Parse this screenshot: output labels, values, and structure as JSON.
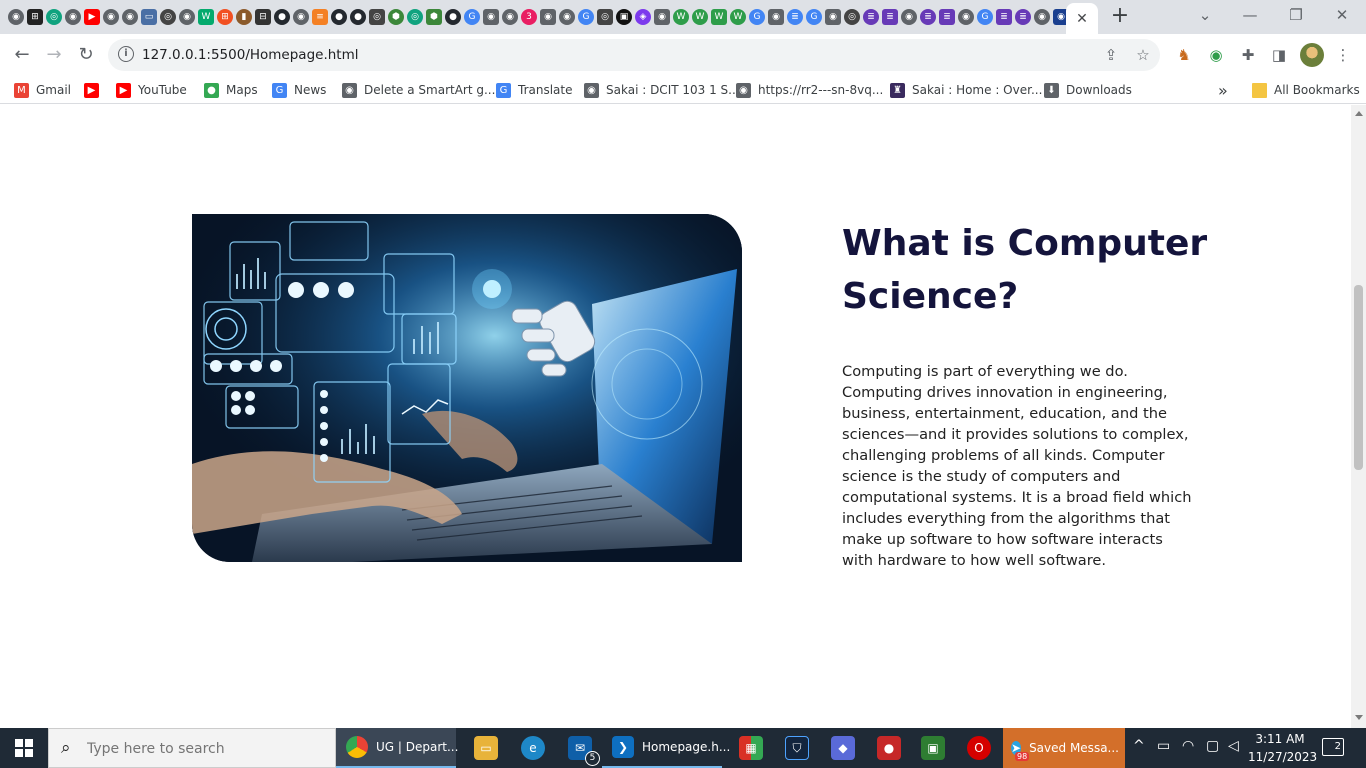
{
  "browser": {
    "address": "127.0.0.1:5500/Homepage.html",
    "close_tab": "✕",
    "new_tab": "+",
    "tab_favicons": [
      {
        "icon": "chrome-icon",
        "color": "#5f6368",
        "glyph": "◉"
      },
      {
        "icon": "app-icon",
        "color": "#222222",
        "glyph": "⊞"
      },
      {
        "icon": "openai-icon",
        "color": "#10a37f",
        "glyph": "◎"
      },
      {
        "icon": "chrome-icon",
        "color": "#5f6368",
        "glyph": "◉"
      },
      {
        "icon": "youtube-icon",
        "color": "#ff0000",
        "glyph": "▶"
      },
      {
        "icon": "chrome-icon",
        "color": "#5f6368",
        "glyph": "◉"
      },
      {
        "icon": "chrome-icon",
        "color": "#5f6368",
        "glyph": "◉"
      },
      {
        "icon": "site-icon",
        "color": "#4a6fa5",
        "glyph": "▭"
      },
      {
        "icon": "openai-icon",
        "color": "#444444",
        "glyph": "◎"
      },
      {
        "icon": "chrome-icon",
        "color": "#5f6368",
        "glyph": "◉"
      },
      {
        "icon": "w3schools-icon",
        "color": "#04aa6d",
        "glyph": "W"
      },
      {
        "icon": "microsoft-icon",
        "color": "#f25022",
        "glyph": "⊞"
      },
      {
        "icon": "book-icon",
        "color": "#8b5a2b",
        "glyph": "▮"
      },
      {
        "icon": "app-icon",
        "color": "#333333",
        "glyph": "⊟"
      },
      {
        "icon": "github-icon",
        "color": "#24292f",
        "glyph": "●"
      },
      {
        "icon": "chrome-icon",
        "color": "#5f6368",
        "glyph": "◉"
      },
      {
        "icon": "stackoverflow-icon",
        "color": "#f48024",
        "glyph": "≡"
      },
      {
        "icon": "github-icon",
        "color": "#24292f",
        "glyph": "●"
      },
      {
        "icon": "github-icon",
        "color": "#24292f",
        "glyph": "●"
      },
      {
        "icon": "openai-icon",
        "color": "#444444",
        "glyph": "◎"
      },
      {
        "icon": "nodejs-icon",
        "color": "#3c873a",
        "glyph": "⬢"
      },
      {
        "icon": "openai-icon",
        "color": "#10a37f",
        "glyph": "◎"
      },
      {
        "icon": "nodejs-icon",
        "color": "#3c873a",
        "glyph": "⬢"
      },
      {
        "icon": "github-icon",
        "color": "#24292f",
        "glyph": "●"
      },
      {
        "icon": "google-icon",
        "color": "#4285f4",
        "glyph": "G"
      },
      {
        "icon": "chrome-icon",
        "color": "#5f6368",
        "glyph": "◉"
      },
      {
        "icon": "chrome-icon",
        "color": "#5f6368",
        "glyph": "◉"
      },
      {
        "icon": "3d-icon",
        "color": "#e91e63",
        "glyph": "3"
      },
      {
        "icon": "chrome-icon",
        "color": "#5f6368",
        "glyph": "◉"
      },
      {
        "icon": "chrome-icon",
        "color": "#5f6368",
        "glyph": "◉"
      },
      {
        "icon": "google-icon",
        "color": "#4285f4",
        "glyph": "G"
      },
      {
        "icon": "openai-icon",
        "color": "#444444",
        "glyph": "◎"
      },
      {
        "icon": "code-icon",
        "color": "#111111",
        "glyph": "▣"
      },
      {
        "icon": "app-icon",
        "color": "#7c3aed",
        "glyph": "◈"
      },
      {
        "icon": "chrome-icon",
        "color": "#5f6368",
        "glyph": "◉"
      },
      {
        "icon": "wattpad-icon",
        "color": "#2e9d4a",
        "glyph": "W"
      },
      {
        "icon": "wattpad-icon",
        "color": "#2e9d4a",
        "glyph": "W"
      },
      {
        "icon": "wattpad-icon",
        "color": "#2e9d4a",
        "glyph": "W"
      },
      {
        "icon": "wattpad-icon",
        "color": "#2e9d4a",
        "glyph": "W"
      },
      {
        "icon": "google-icon",
        "color": "#4285f4",
        "glyph": "G"
      },
      {
        "icon": "chrome-icon",
        "color": "#5f6368",
        "glyph": "◉"
      },
      {
        "icon": "docs-icon",
        "color": "#4285f4",
        "glyph": "≣"
      },
      {
        "icon": "google-icon",
        "color": "#4285f4",
        "glyph": "G"
      },
      {
        "icon": "chrome-icon",
        "color": "#5f6368",
        "glyph": "◉"
      },
      {
        "icon": "openai-icon",
        "color": "#444444",
        "glyph": "◎"
      },
      {
        "icon": "forms-icon",
        "color": "#673ab7",
        "glyph": "≣"
      },
      {
        "icon": "forms-icon",
        "color": "#673ab7",
        "glyph": "≣"
      },
      {
        "icon": "chrome-icon",
        "color": "#5f6368",
        "glyph": "◉"
      },
      {
        "icon": "forms-icon",
        "color": "#673ab7",
        "glyph": "≣"
      },
      {
        "icon": "forms-icon",
        "color": "#673ab7",
        "glyph": "≣"
      },
      {
        "icon": "chrome-icon",
        "color": "#5f6368",
        "glyph": "◉"
      },
      {
        "icon": "google-icon",
        "color": "#4285f4",
        "glyph": "G"
      },
      {
        "icon": "forms-icon",
        "color": "#673ab7",
        "glyph": "≣"
      },
      {
        "icon": "forms-icon",
        "color": "#673ab7",
        "glyph": "≣"
      },
      {
        "icon": "chrome-icon",
        "color": "#5f6368",
        "glyph": "◉"
      },
      {
        "icon": "site-icon",
        "color": "#1a3f8f",
        "glyph": "◉"
      },
      {
        "icon": "chrome-icon",
        "color": "#5f6368",
        "glyph": "◉"
      }
    ]
  },
  "bookmarks": [
    {
      "label": "Gmail",
      "icon": "gmail-icon",
      "color": "#ea4335",
      "glyph": "M"
    },
    {
      "label": "",
      "icon": "youtube-icon",
      "color": "#ff0000",
      "glyph": "▶"
    },
    {
      "label": "YouTube",
      "icon": "youtube-icon",
      "color": "#ff0000",
      "glyph": "▶"
    },
    {
      "label": "Maps",
      "icon": "maps-icon",
      "color": "#34a853",
      "glyph": "●"
    },
    {
      "label": "News",
      "icon": "news-icon",
      "color": "#4285f4",
      "glyph": "G"
    },
    {
      "label": "Delete a SmartArt g...",
      "icon": "globe-icon",
      "color": "#5f6368",
      "glyph": "◉"
    },
    {
      "label": "Translate",
      "icon": "translate-icon",
      "color": "#4285f4",
      "glyph": "G"
    },
    {
      "label": "Sakai : DCIT 103 1 S...",
      "icon": "globe-icon",
      "color": "#5f6368",
      "glyph": "◉"
    },
    {
      "label": "https://rr2---sn-8vq...",
      "icon": "globe-icon",
      "color": "#5f6368",
      "glyph": "◉"
    },
    {
      "label": "Sakai : Home : Over...",
      "icon": "sakai-icon",
      "color": "#3a2a5e",
      "glyph": "♜"
    },
    {
      "label": "Downloads",
      "icon": "download-icon",
      "color": "#5f6368",
      "glyph": "⬇"
    }
  ],
  "bookmarks_more": "»",
  "all_bookmarks": "All Bookmarks",
  "page": {
    "title": "What is Computer Science?",
    "paragraph": "Computing is part of everything we do. Computing drives innovation in engineering, business, entertainment, education, and the sciences—and it provides solutions to complex, challenging problems of all kinds. Computer science is the study of computers and computational systems. It is a broad field which includes everything from the algorithms that make up software to how software interacts with hardware to how well software."
  },
  "taskbar": {
    "search_placeholder": "Type here to search",
    "chrome_label": "UG | Depart...",
    "vscode_label": "Homepage.h...",
    "telegram_label": "Saved Messa...",
    "telegram_badge": "98",
    "mail_badge": "5",
    "time": "3:11 AM",
    "date": "11/27/2023",
    "notifications": "2"
  }
}
